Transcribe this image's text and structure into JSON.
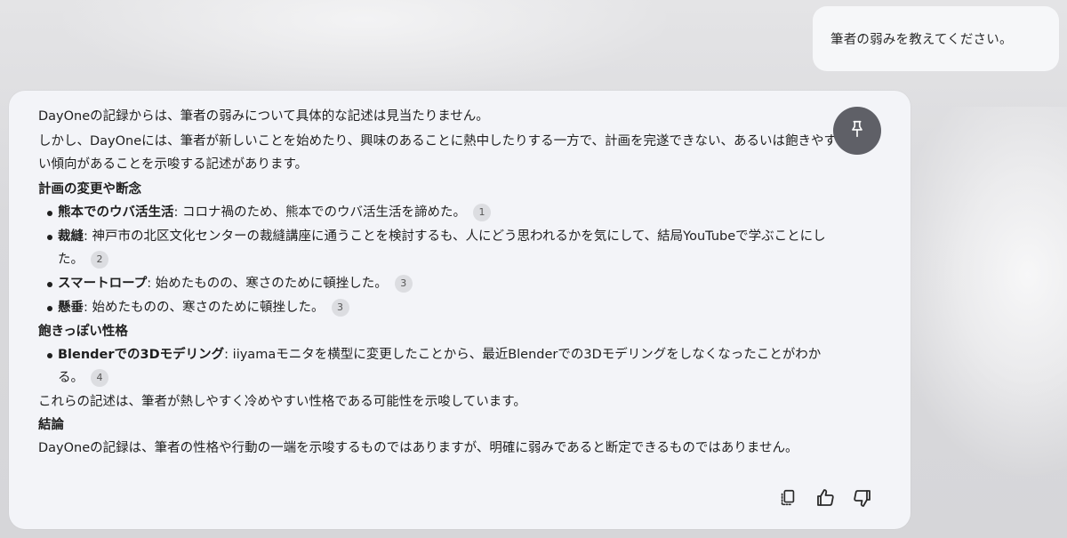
{
  "user_message": {
    "text": "筆者の弱みを教えてください。"
  },
  "answer": {
    "intro_1": "DayOneの記録からは、筆者の弱みについて具体的な記述は見当たりません。",
    "intro_2": "しかし、DayOneには、筆者が新しいことを始めたり、興味のあることに熱中したりする一方で、計画を完遂できない、あるいは飽きやすい傾向があることを示唆する記述があります。",
    "section_1": {
      "heading": "計画の変更や断念",
      "items": [
        {
          "term": "熊本でのウバ活生活",
          "text": ": コロナ禍のため、熊本でのウバ活生活を諦めた。",
          "cite": "1"
        },
        {
          "term": "裁縫",
          "text": ": 神戸市の北区文化センターの裁縫講座に通うことを検討するも、人にどう思われるかを気にして、結局YouTubeで学ぶことにした。",
          "cite": "2"
        },
        {
          "term": "スマートロープ",
          "text": ": 始めたものの、寒さのために頓挫した。",
          "cite": "3"
        },
        {
          "term": "懸垂",
          "text": ": 始めたものの、寒さのために頓挫した。",
          "cite": "3"
        }
      ]
    },
    "section_2": {
      "heading": "飽きっぽい性格",
      "items": [
        {
          "term": "Blenderでの3Dモデリング",
          "text": ": iiyamaモニタを横型に変更したことから、最近Blenderでの3Dモデリングをしなくなったことがわかる。",
          "cite": "4"
        }
      ]
    },
    "summary": "これらの記述は、筆者が熱しやすく冷めやすい性格である可能性を示唆しています。",
    "conclusion_heading": "結論",
    "conclusion": "DayOneの記録は、筆者の性格や行動の一端を示唆するものではありますが、明確に弱みであると断定できるものではありません。"
  },
  "icons": {
    "pin": "pin-icon",
    "copy": "copy-icon",
    "thumbs_up": "thumbs-up-icon",
    "thumbs_down": "thumbs-down-icon"
  },
  "colors": {
    "card_bg": "#f3f4f8",
    "pin_bg": "#5f6067",
    "citation_bg": "#dcdde1"
  }
}
